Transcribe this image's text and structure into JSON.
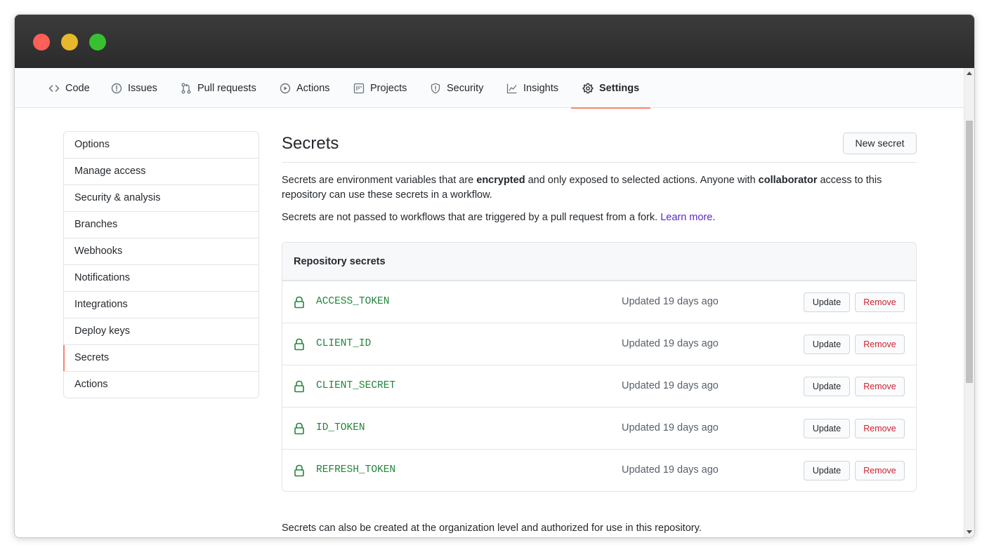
{
  "nav": {
    "tabs": [
      {
        "label": "Code",
        "icon": "code-icon"
      },
      {
        "label": "Issues",
        "icon": "issue-icon"
      },
      {
        "label": "Pull requests",
        "icon": "pull-request-icon"
      },
      {
        "label": "Actions",
        "icon": "play-icon"
      },
      {
        "label": "Projects",
        "icon": "project-icon"
      },
      {
        "label": "Security",
        "icon": "shield-icon"
      },
      {
        "label": "Insights",
        "icon": "graph-icon"
      },
      {
        "label": "Settings",
        "icon": "gear-icon",
        "active": true
      }
    ]
  },
  "sidebar": {
    "items": [
      {
        "label": "Options"
      },
      {
        "label": "Manage access"
      },
      {
        "label": "Security & analysis"
      },
      {
        "label": "Branches"
      },
      {
        "label": "Webhooks"
      },
      {
        "label": "Notifications"
      },
      {
        "label": "Integrations"
      },
      {
        "label": "Deploy keys"
      },
      {
        "label": "Secrets",
        "active": true
      },
      {
        "label": "Actions"
      }
    ]
  },
  "main": {
    "title": "Secrets",
    "new_secret_label": "New secret",
    "desc1": {
      "part1": "Secrets are environment variables that are ",
      "bold1": "encrypted",
      "part2": " and only exposed to selected actions. Anyone with ",
      "bold2": "collaborator",
      "part3": " access to this repository can use these secrets in a workflow."
    },
    "desc2": {
      "text": "Secrets are not passed to workflows that are triggered by a pull request from a fork. ",
      "link": "Learn more",
      "end": "."
    },
    "panel_title": "Repository secrets",
    "secrets": [
      {
        "name": "ACCESS_TOKEN",
        "updated": "Updated 19 days ago"
      },
      {
        "name": "CLIENT_ID",
        "updated": "Updated 19 days ago"
      },
      {
        "name": "CLIENT_SECRET",
        "updated": "Updated 19 days ago"
      },
      {
        "name": "ID_TOKEN",
        "updated": "Updated 19 days ago"
      },
      {
        "name": "REFRESH_TOKEN",
        "updated": "Updated 19 days ago"
      }
    ],
    "update_label": "Update",
    "remove_label": "Remove",
    "footer_note": "Secrets can also be created at the organization level and authorized for use in this repository."
  },
  "colors": {
    "accent_underline": "#f9826c",
    "secret_green": "#22863a",
    "danger_red": "#cb2431",
    "link_purple": "#5a28c6"
  }
}
